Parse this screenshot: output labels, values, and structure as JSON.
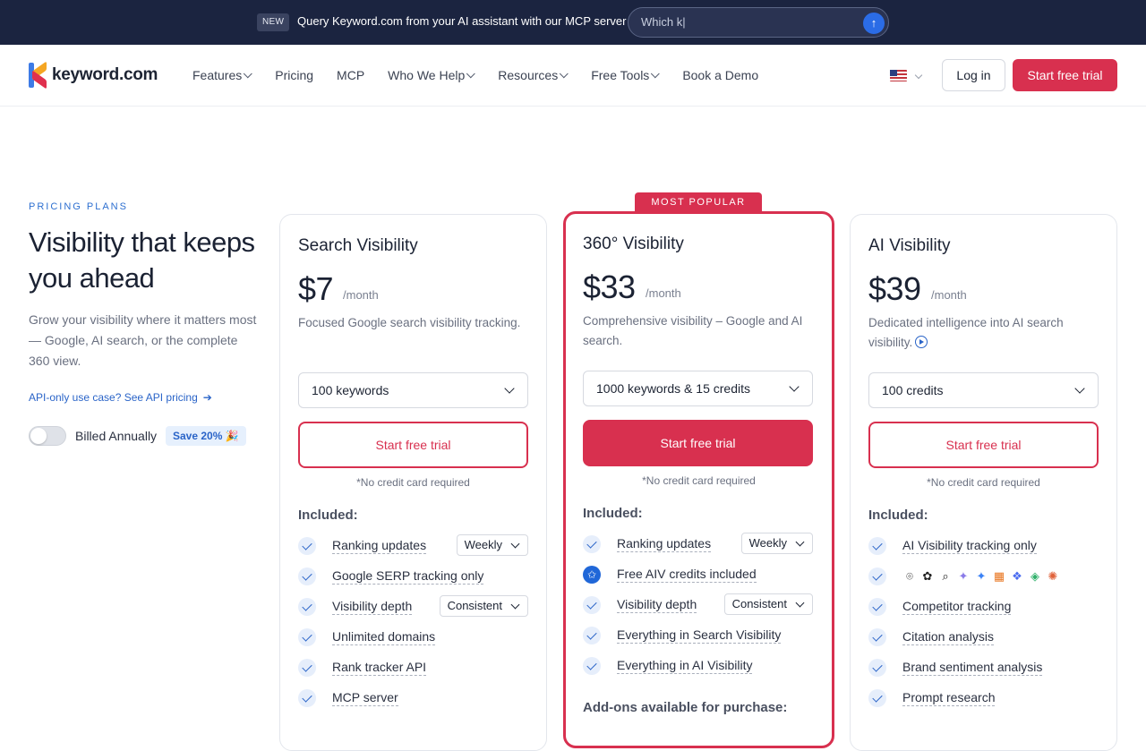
{
  "announcement": {
    "badge": "NEW",
    "message": "Query Keyword.com from your AI assistant with our MCP server",
    "input_value": "Which k|",
    "send_icon": "arrow-up-icon"
  },
  "nav": {
    "logo_text": "keyword.com",
    "items": [
      {
        "label": "Features",
        "dropdown": true
      },
      {
        "label": "Pricing",
        "dropdown": false
      },
      {
        "label": "MCP",
        "dropdown": false
      },
      {
        "label": "Who We Help",
        "dropdown": true
      },
      {
        "label": "Resources",
        "dropdown": true
      },
      {
        "label": "Free Tools",
        "dropdown": true
      },
      {
        "label": "Book a Demo",
        "dropdown": false
      }
    ],
    "login": "Log in",
    "trial": "Start free trial"
  },
  "intro": {
    "eyebrow": "PRICING PLANS",
    "headline": "Visibility that keeps you ahead",
    "subtext": "Grow your visibility where it matters most — Google, AI search, or the complete 360 view.",
    "api_link": "API-only use case? See API pricing",
    "billed": "Billed Annually",
    "save": "Save 20% 🎉"
  },
  "plans": [
    {
      "name": "Search Visibility",
      "price": "$7",
      "per": "/month",
      "desc": "Focused Google search visibility tracking.",
      "select": "100 keywords",
      "cta": "Start free trial",
      "no_cc": "*No credit card required",
      "included": "Included:",
      "features": [
        {
          "label": "Ranking updates",
          "select": "Weekly"
        },
        {
          "label": "Google SERP tracking only"
        },
        {
          "label": "Visibility depth",
          "select": "Consistent"
        },
        {
          "label": "Unlimited domains"
        },
        {
          "label": "Rank tracker API"
        },
        {
          "label": "MCP server"
        }
      ]
    },
    {
      "tag": "MOST POPULAR",
      "name": "360° Visibility",
      "price": "$33",
      "per": "/month",
      "desc": "Comprehensive visibility – Google and AI search.",
      "select": "1000 keywords & 15 credits",
      "cta": "Start free trial",
      "no_cc": "*No credit card required",
      "included": "Included:",
      "features": [
        {
          "label": "Ranking updates",
          "select": "Weekly"
        },
        {
          "label": "Free AIV credits included",
          "icon": "star-icon"
        },
        {
          "label": "Visibility depth",
          "select": "Consistent"
        },
        {
          "label": "Everything in Search Visibility"
        },
        {
          "label": "Everything in AI Visibility"
        }
      ],
      "addons": "Add-ons available for purchase:"
    },
    {
      "name": "AI Visibility",
      "price": "$39",
      "per": "/month",
      "desc": "Dedicated intelligence into AI search visibility.",
      "select": "100 credits",
      "cta": "Start free trial",
      "no_cc": "*No credit card required",
      "included": "Included:",
      "features": [
        {
          "label": "AI Visibility tracking only"
        },
        {
          "label": "",
          "logos": true
        },
        {
          "label": "Competitor tracking"
        },
        {
          "label": "Citation analysis"
        },
        {
          "label": "Brand sentiment analysis"
        },
        {
          "label": "Prompt research"
        }
      ]
    }
  ],
  "colors": {
    "brand": "#d8304f",
    "announce_bg": "#1b2440",
    "link": "#2a64c8"
  }
}
